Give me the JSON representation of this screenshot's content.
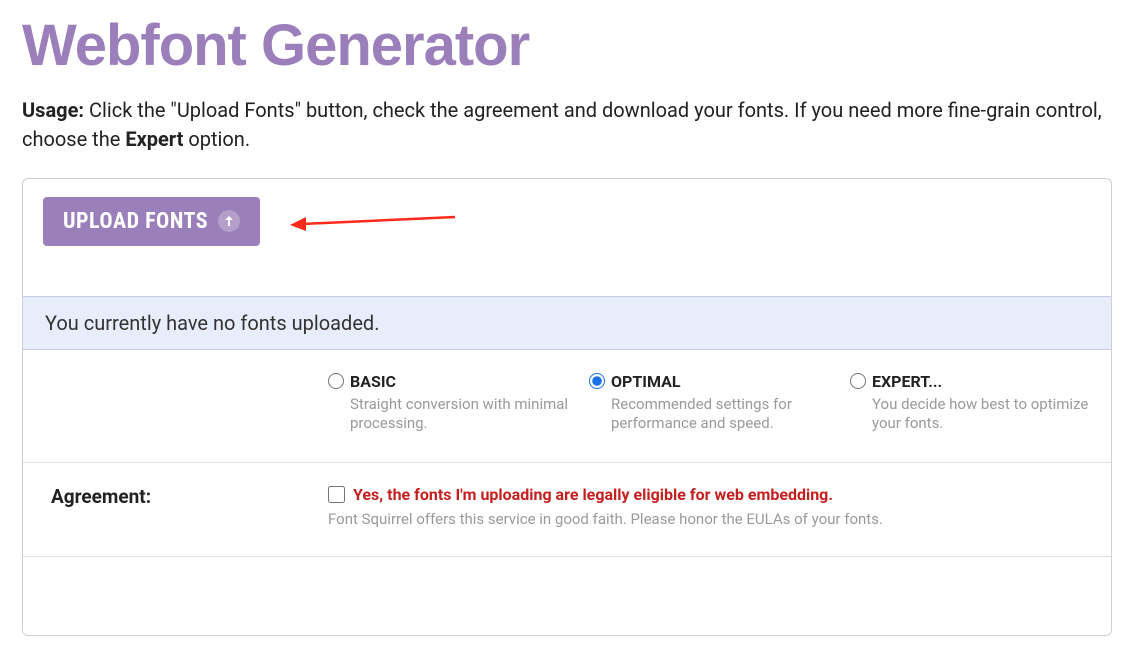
{
  "page": {
    "title": "Webfont Generator"
  },
  "usage": {
    "label": "Usage:",
    "text_part1": " Click the \"Upload Fonts\" button, check the agreement and download your fonts. If you need more fine-grain control, choose the ",
    "expert_word": "Expert",
    "text_part2": " option."
  },
  "upload": {
    "button_label": "UPLOAD FONTS"
  },
  "status": {
    "message": "You currently have no fonts uploaded."
  },
  "options": {
    "basic": {
      "label": "BASIC",
      "desc": "Straight conversion with minimal processing."
    },
    "optimal": {
      "label": "OPTIMAL",
      "desc": "Recommended settings for performance and speed."
    },
    "expert": {
      "label": "EXPERT...",
      "desc": "You decide how best to optimize your fonts."
    },
    "selected": "optimal"
  },
  "agreement": {
    "section_label": "Agreement:",
    "checkbox_label": "Yes, the fonts I'm uploading are legally eligible for web embedding.",
    "note": "Font Squirrel offers this service in good faith. Please honor the EULAs of your fonts."
  },
  "colors": {
    "accent": "#9b7fba",
    "status_bg": "#e8edfb",
    "muted": "#9a9a9a",
    "danger": "#c52020"
  }
}
